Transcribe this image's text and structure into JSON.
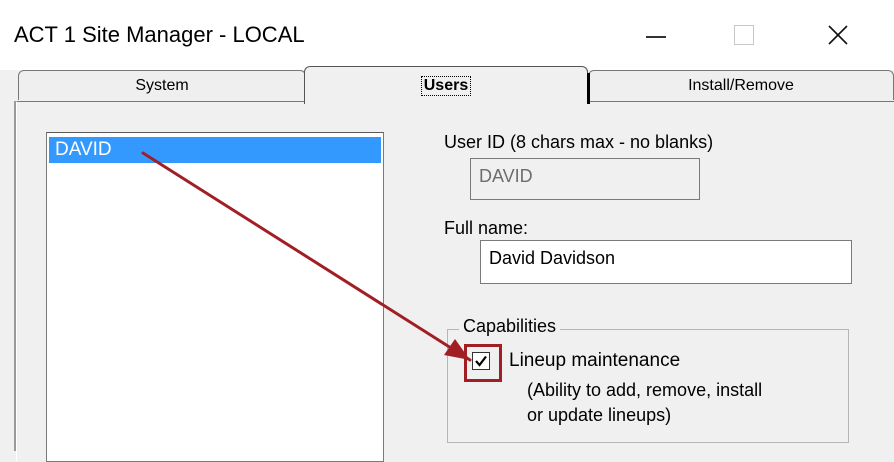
{
  "window": {
    "title": "ACT 1 Site Manager - LOCAL"
  },
  "tabs": [
    {
      "label": "System"
    },
    {
      "label": "Users"
    },
    {
      "label": "Install/Remove"
    }
  ],
  "users_list": {
    "items": [
      "DAVID"
    ],
    "selected": "DAVID"
  },
  "user_id": {
    "label": "User ID (8 chars max - no blanks)",
    "value": "DAVID"
  },
  "full_name": {
    "label": "Full name:",
    "value": "David Davidson"
  },
  "capabilities": {
    "title": "Capabilities",
    "lineup_label": "Lineup maintenance",
    "lineup_desc_line1": "(Ability to add, remove, install",
    "lineup_desc_line2": "or update lineups)",
    "lineup_checked": true
  },
  "colors": {
    "selection": "#3399ff",
    "annotation": "#a11f24"
  }
}
